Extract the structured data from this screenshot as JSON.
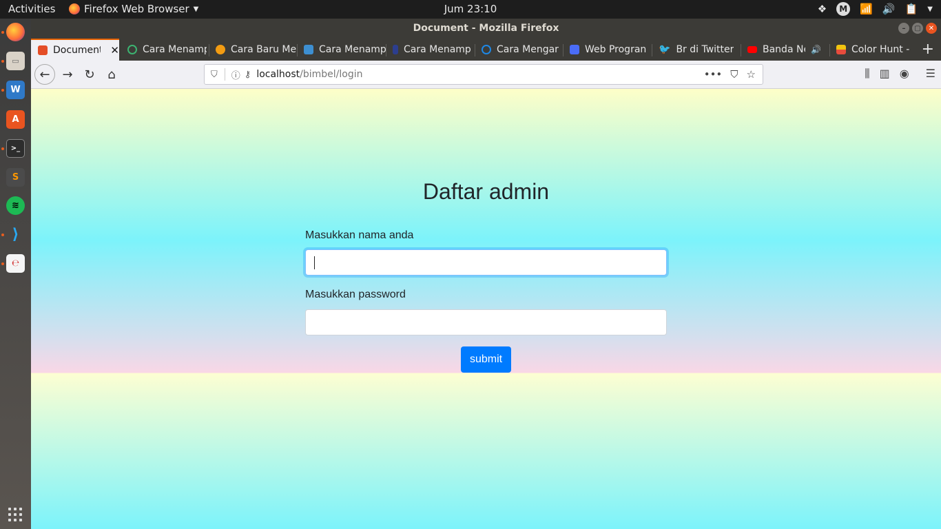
{
  "topbar": {
    "activities": "Activities",
    "app_menu": "Firefox Web Browser",
    "clock": "Jum 23:10",
    "user_initial": "M"
  },
  "window": {
    "title": "Document - Mozilla Firefox"
  },
  "tabs": [
    {
      "label": "Document",
      "active": true,
      "favicon_color": "#e44d26"
    },
    {
      "label": "Cara Menamp",
      "active": false,
      "favicon_color": "#3cb371"
    },
    {
      "label": "Cara Baru Me",
      "active": false,
      "favicon_color": "#f39c12"
    },
    {
      "label": "Cara Menamp",
      "active": false,
      "favicon_color": "#3d8fd1"
    },
    {
      "label": "Cara Menamp",
      "active": false,
      "favicon_color": "#2c3e8f"
    },
    {
      "label": "Cara Mengar",
      "active": false,
      "favicon_color": "#1e88e5"
    },
    {
      "label": "Web Progran",
      "active": false,
      "favicon_color": "#4a6cf7"
    },
    {
      "label": "Br di Twitter",
      "active": false,
      "favicon_color": "#1da1f2"
    },
    {
      "label": "Banda Nei",
      "active": false,
      "favicon_color": "#ff0000"
    },
    {
      "label": "Color Hunt -",
      "active": false,
      "favicon_color": "#f1c40f"
    }
  ],
  "navbar": {
    "url_host": "localhost",
    "url_path": "/bimbel/login"
  },
  "page": {
    "heading": "Daftar admin",
    "name_label": "Masukkan nama anda",
    "name_value": "",
    "password_label": "Masukkan password",
    "password_value": "",
    "submit_label": "submit"
  },
  "colors": {
    "submit_button": "#007bff",
    "focus_border": "#80bdff",
    "gradient_top": "#fefec8",
    "gradient_cyan": "#7cf3fb",
    "gradient_pink": "#f9d7e6"
  }
}
